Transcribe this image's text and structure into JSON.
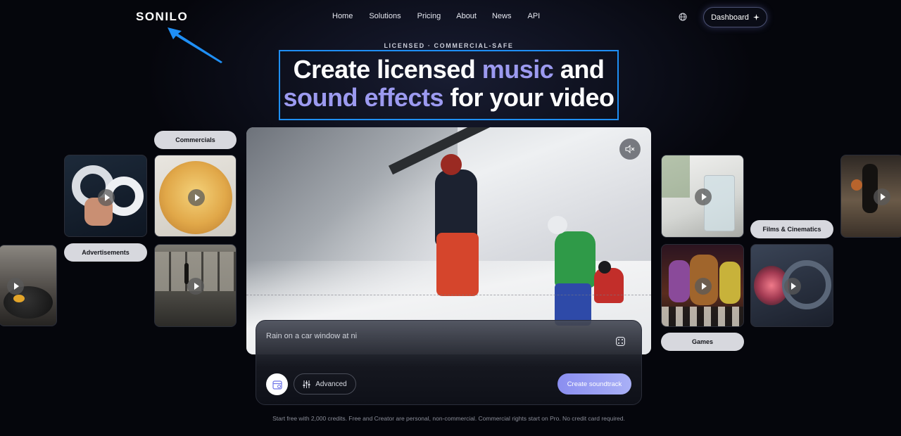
{
  "brand": {
    "logo": "SONILO"
  },
  "nav": {
    "items": [
      "Home",
      "Solutions",
      "Pricing",
      "About",
      "News",
      "API"
    ]
  },
  "header": {
    "globe_icon": "globe-icon",
    "dashboard_label": "Dashboard",
    "dashboard_icon": "sparkle-icon"
  },
  "hero": {
    "eyebrow": "LICENSED · COMMERCIAL-SAFE",
    "headline_part1": "Create licensed ",
    "headline_highlight1": "music",
    "headline_part2": " and",
    "headline_highlight2": "sound effects",
    "headline_part3": " for your video",
    "accent_color": "#9c9af0",
    "annotation_color": "#1f8ff5"
  },
  "categories": {
    "commercials": "Commercials",
    "advertisements": "Advertisements",
    "films": "Films & Cinematics",
    "games": "Games"
  },
  "prompt": {
    "value": "Rain on a car window at ni",
    "advanced_label": "Advanced",
    "create_label": "Create soundtrack"
  },
  "footnote": "Start free with 2,000 credits. Free and Creator are personal, non-commercial. Commercial rights start on Pro. No credit card required."
}
